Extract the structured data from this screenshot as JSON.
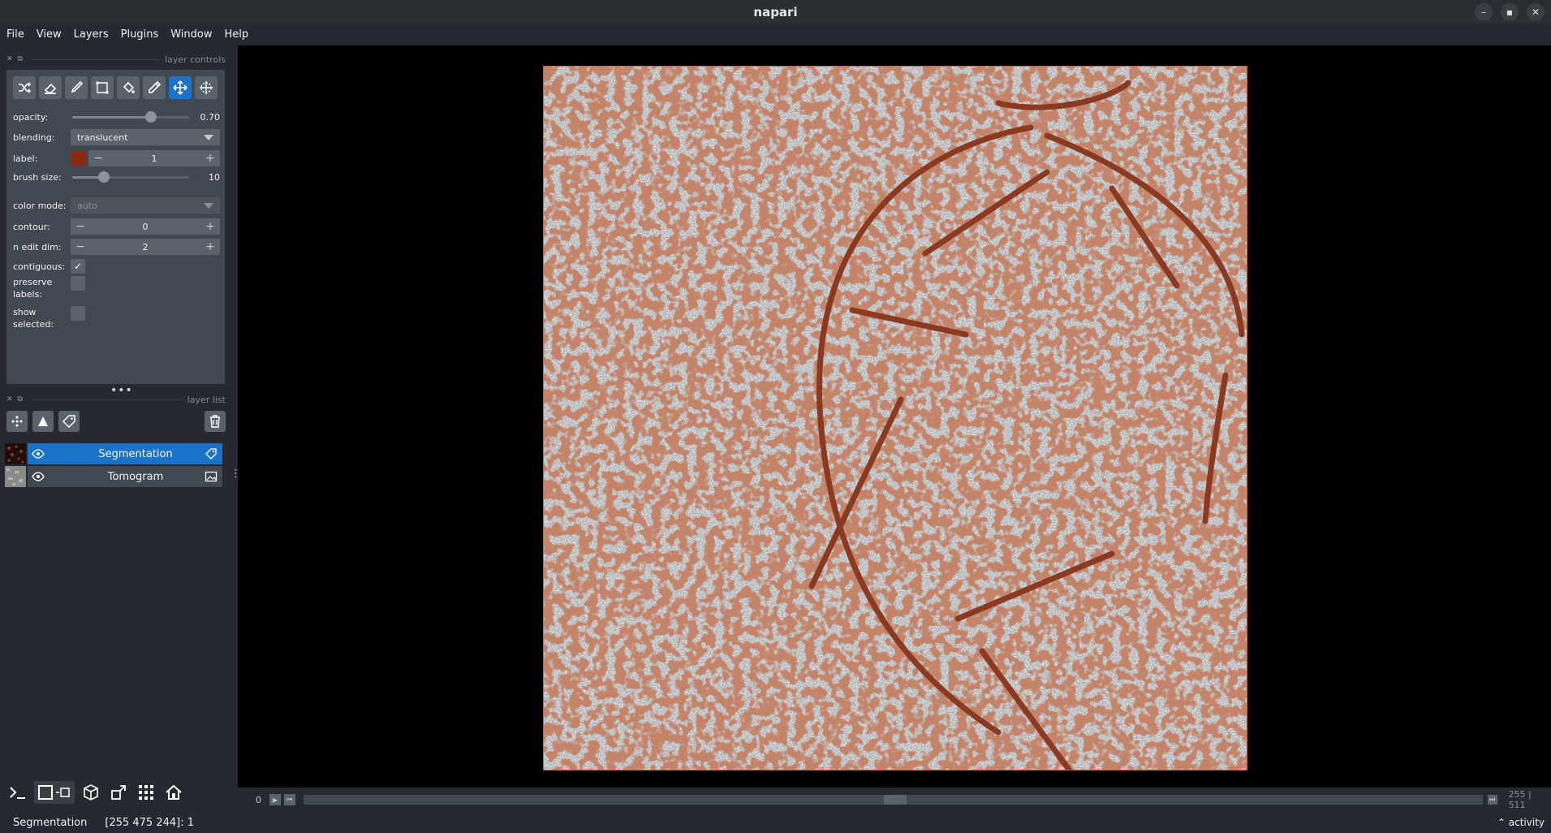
{
  "window": {
    "title": "napari"
  },
  "menu": [
    "File",
    "View",
    "Layers",
    "Plugins",
    "Window",
    "Help"
  ],
  "layer_controls": {
    "header": "layer controls",
    "tools": [
      "shuffle-colors-icon",
      "eraser-icon",
      "paintbrush-icon",
      "polygon-icon",
      "fill-bucket-icon",
      "color-picker-icon",
      "pan-zoom-icon",
      "transform-icon"
    ],
    "active_tool": "pan-zoom-icon",
    "opacity": {
      "label": "opacity:",
      "value": "0.70",
      "level": 0.7
    },
    "blending": {
      "label": "blending:",
      "value": "translucent"
    },
    "label": {
      "label": "label:",
      "value": "1",
      "color": "#8b2a10"
    },
    "brush_size": {
      "label": "brush size:",
      "value": "10",
      "level": 0.19
    },
    "color_mode": {
      "label": "color mode:",
      "value": "auto"
    },
    "contour": {
      "label": "contour:",
      "value": "0"
    },
    "n_edit_dim": {
      "label": "n edit dim:",
      "value": "2"
    },
    "contiguous": {
      "label": "contiguous:",
      "checked": true
    },
    "preserve_labels": {
      "label1": "preserve",
      "label2": "labels:",
      "checked": false
    },
    "show_selected": {
      "label1": "show",
      "label2": "selected:",
      "checked": false
    }
  },
  "layer_list": {
    "header": "layer list",
    "layers": [
      {
        "name": "Segmentation",
        "selected": true,
        "type_icon": "labels-icon"
      },
      {
        "name": "Tomogram",
        "selected": false,
        "type_icon": "image-icon"
      }
    ]
  },
  "dims": {
    "index": "0",
    "current": "255",
    "max": "511",
    "fraction": 0.5
  },
  "status": {
    "layer": "Segmentation",
    "coords": "[255 475 244]: 1",
    "activity": "activity"
  },
  "colors": {
    "accent": "#1a73c9",
    "panel": "#414851",
    "background": "#262930",
    "segmentation": "#8b3a22"
  }
}
